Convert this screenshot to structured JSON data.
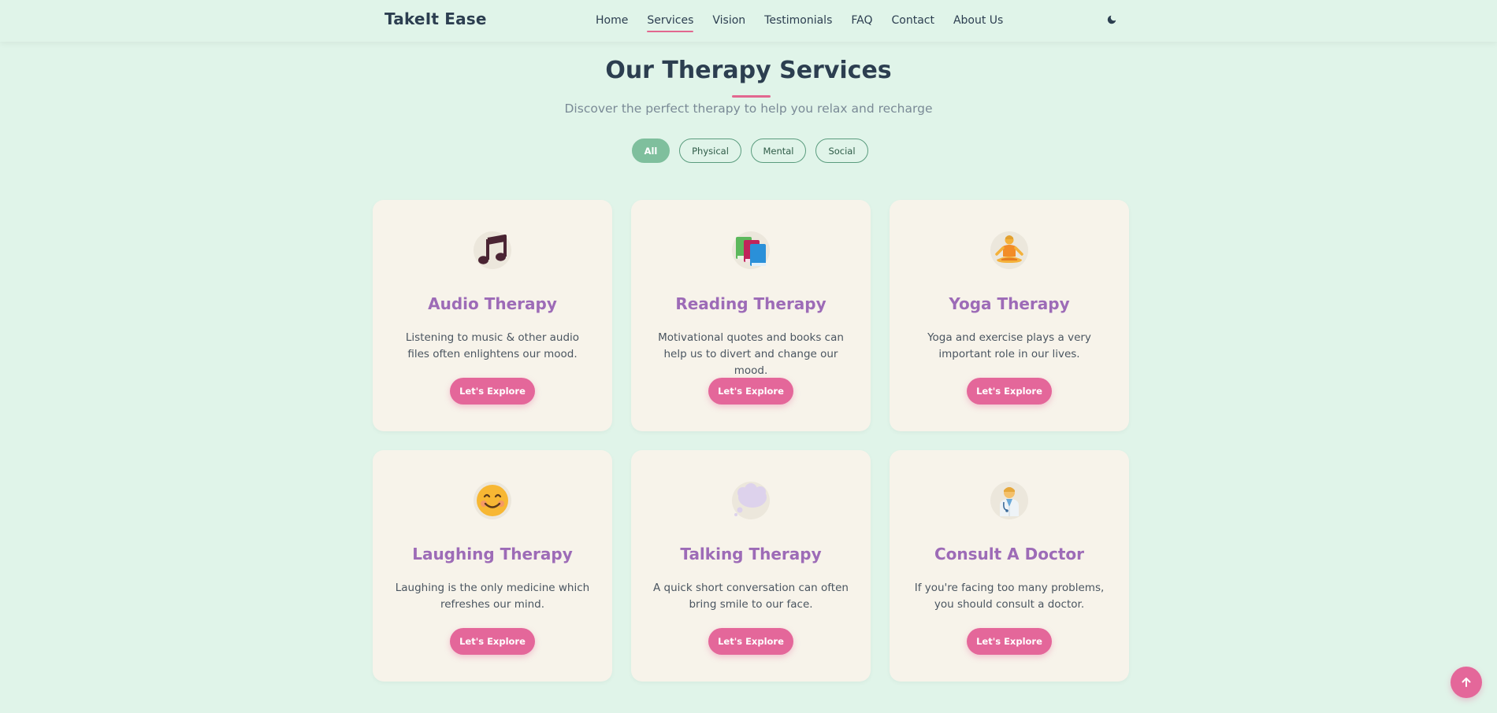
{
  "nav": {
    "brand": "TakeIt Ease",
    "links": [
      {
        "label": "Home",
        "active": false
      },
      {
        "label": "Services",
        "active": true
      },
      {
        "label": "Vision",
        "active": false
      },
      {
        "label": "Testimonials",
        "active": false
      },
      {
        "label": "FAQ",
        "active": false
      },
      {
        "label": "Contact",
        "active": false
      },
      {
        "label": "About Us",
        "active": false
      }
    ],
    "theme_toggle_icon": "moon-icon"
  },
  "header": {
    "title": "Our Therapy Services",
    "subtitle": "Discover the perfect therapy to help you relax and recharge"
  },
  "filters": [
    {
      "label": "All",
      "active": true
    },
    {
      "label": "Physical",
      "active": false
    },
    {
      "label": "Mental",
      "active": false
    },
    {
      "label": "Social",
      "active": false
    }
  ],
  "cards": [
    {
      "icon": "music-notes-icon",
      "title": "Audio Therapy",
      "description": "Listening to music & other audio files often enlightens our mood.",
      "button": "Let's Explore"
    },
    {
      "icon": "books-icon",
      "title": "Reading Therapy",
      "description": "Motivational quotes and books can help us to divert and change our mood.",
      "button": "Let's Explore"
    },
    {
      "icon": "yoga-person-icon",
      "title": "Yoga Therapy",
      "description": "Yoga and exercise plays a very important role in our lives.",
      "button": "Let's Explore"
    },
    {
      "icon": "smiling-face-icon",
      "title": "Laughing Therapy",
      "description": "Laughing is the only medicine which refreshes our mind.",
      "button": "Let's Explore"
    },
    {
      "icon": "thought-bubble-icon",
      "title": "Talking Therapy",
      "description": "A quick short conversation can often bring smile to our face.",
      "button": "Let's Explore"
    },
    {
      "icon": "doctor-icon",
      "title": "Consult A Doctor",
      "description": "If you're facing too many problems, you should consult a doctor.",
      "button": "Let's Explore"
    }
  ],
  "scroll_top_icon": "arrow-up-icon",
  "colors": {
    "background": "#e0f4e9",
    "card": "#f7f3ea",
    "accent_pink": "#e4679a",
    "title_purple": "#9d6bb7",
    "filter_active": "#7fbf9d"
  }
}
